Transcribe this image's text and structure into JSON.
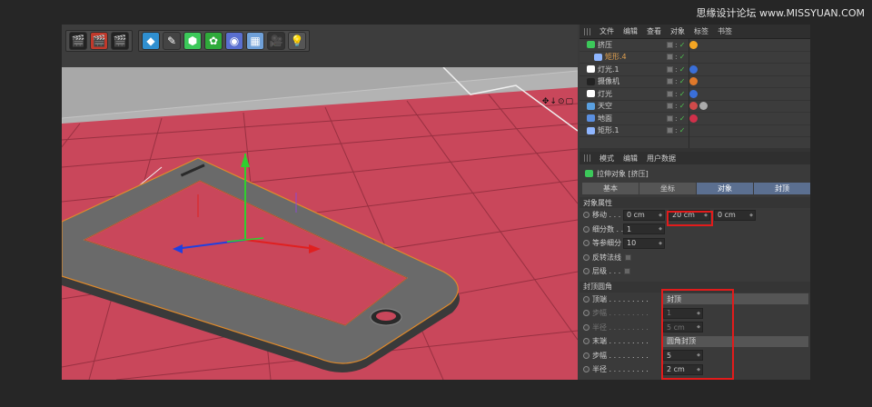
{
  "watermark": "思缘设计论坛 www.MISSYUAN.COM",
  "object_manager": {
    "menu": [
      "文件",
      "编辑",
      "查看",
      "对象",
      "标签",
      "书签"
    ],
    "objects": [
      {
        "name": "挤压",
        "icon_color": "#3cc85a",
        "indent": 0,
        "tags": [
          "#f5a623"
        ]
      },
      {
        "name": "矩形.4",
        "icon_color": "#8fb6ff",
        "indent": 1,
        "tags": []
      },
      {
        "name": "灯光.1",
        "icon_color": "#ffffff",
        "indent": 0,
        "tags": [
          "#3a6fd8"
        ]
      },
      {
        "name": "摄像机",
        "icon_color": "#222222",
        "indent": 0,
        "tags": [
          "#e0792a"
        ]
      },
      {
        "name": "灯光",
        "icon_color": "#ffffff",
        "indent": 0,
        "tags": [
          "#3a6fd8"
        ]
      },
      {
        "name": "天空",
        "icon_color": "#5aa0e0",
        "indent": 0,
        "tags": [
          "#d04a4a",
          "#aaaaaa"
        ]
      },
      {
        "name": "地面",
        "icon_color": "#5a8fe0",
        "indent": 0,
        "tags": [
          "#d0304a"
        ]
      },
      {
        "name": "矩形.1",
        "icon_color": "#8fb6ff",
        "indent": 0,
        "tags": []
      }
    ]
  },
  "attributes": {
    "menu": [
      "模式",
      "编辑",
      "用户数据"
    ],
    "title": "拉伸对象 [挤压]",
    "tabs": [
      {
        "label": "基本",
        "active": false
      },
      {
        "label": "坐标",
        "active": false
      },
      {
        "label": "对象",
        "active": true
      },
      {
        "label": "封顶",
        "active": true
      }
    ],
    "section1": "对象属性",
    "move_label": "移动 . . .",
    "move_values": [
      "0 cm",
      "20 cm",
      "0 cm"
    ],
    "subdiv_label": "细分数 . .",
    "subdiv_value": "1",
    "iso_label": "等参细分",
    "iso_value": "10",
    "flip_label": "反转法线",
    "hier_label": "层级 . . .",
    "section2": "封顶圆角",
    "top_label": "顶端 . . . . . . . . .",
    "top_value": "封顶",
    "step1_label": "步幅 . . . . . . . . .",
    "step1_value": "1",
    "radius1_label": "半径 . . . . . . . . .",
    "radius1_value": "5 cm",
    "end_label": "末端 . . . . . . . . .",
    "end_value": "圆角封顶",
    "step2_label": "步幅 . . . . . . . . .",
    "step2_value": "5",
    "radius2_label": "半径 . . . . . . . . .",
    "radius2_value": "2 cm"
  }
}
